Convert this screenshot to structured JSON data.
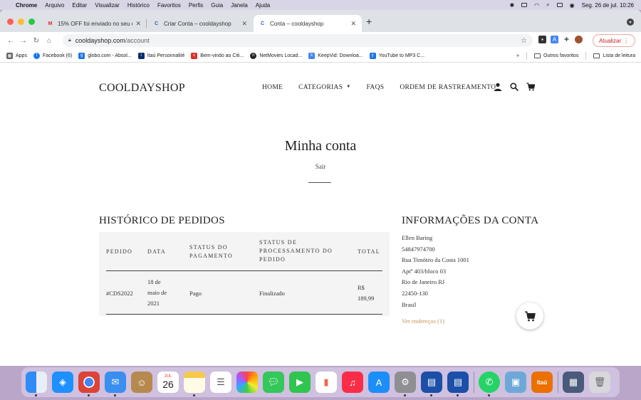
{
  "menubar": {
    "app": "Chrome",
    "items": [
      "Arquivo",
      "Editar",
      "Visualizar",
      "Histórico",
      "Favoritos",
      "Perfis",
      "Guia",
      "Janela",
      "Ajuda"
    ],
    "datetime": "Seg. 26 de jul.  10:26"
  },
  "tabs": [
    {
      "title": "15% OFF foi enviado no seu ca",
      "icon": "gmail-icon"
    },
    {
      "title": "Criar Conta – cooldayshop",
      "icon": "site-icon"
    },
    {
      "title": "Conta – cooldayshop",
      "icon": "site-icon"
    }
  ],
  "toolbar": {
    "url_domain": "cooldayshop.com",
    "url_path": "/account",
    "update_label": "Atualizar"
  },
  "bookmarks": {
    "items": [
      {
        "label": "Apps",
        "color": "#5f6368"
      },
      {
        "label": "Facebook (6)",
        "color": "#1877f2"
      },
      {
        "label": "globo.com - Absol...",
        "color": "#1a73e8"
      },
      {
        "label": "Itaú Personnalité",
        "color": "#0b2a6b"
      },
      {
        "label": "Bem-vindo ao Citi...",
        "color": "#d93025"
      },
      {
        "label": "NetMovies Locad...",
        "color": "#222222"
      },
      {
        "label": "KeepVid: Downloa...",
        "color": "#4285f4"
      },
      {
        "label": "YouTube to MP3 C...",
        "color": "#1a73e8"
      }
    ],
    "more": "»",
    "other_label": "Outros favoritos",
    "reading_label": "Lista de leitura"
  },
  "site": {
    "logo": "COOLDAYSHOP",
    "nav": [
      "HOME",
      "CATEGORIAS",
      "FAQS",
      "ORDEM DE RASTREAMENTO"
    ]
  },
  "account": {
    "title": "Minha conta",
    "logout": "Sair",
    "orders_title": "HISTÓRICO DE PEDIDOS",
    "columns": {
      "pedido": "PEDIDO",
      "data": "DATA",
      "status_pag_1": "STATUS DO",
      "status_pag_2": "PAGAMENTO",
      "status_proc_1": "STATUS DE",
      "status_proc_2": "PROCESSAMENTO DO",
      "status_proc_3": "PEDIDO",
      "total": "TOTAL"
    },
    "order": {
      "id": "#CDS2022",
      "date_1": "18 de",
      "date_2": "maio de",
      "date_3": "2021",
      "payment_status": "Pago",
      "processing_status": "Finalizado",
      "total_1": "R$",
      "total_2": "189,99"
    },
    "info_title": "INFORMAÇÕES DA CONTA",
    "info": {
      "name": "Ellen Baring",
      "phone": "54847974700",
      "street": "Rua Timóteo da Costa 1001",
      "complement": "Aptº 403/bloco 03",
      "city": "Rio de Janeiro RJ",
      "zip": "22450-130",
      "country": "Brasil",
      "addresses_link": "Ver endereços (1)"
    }
  },
  "dock": {
    "calendar_month": "JUL",
    "calendar_day": "26",
    "itau_label": "Itaú"
  }
}
